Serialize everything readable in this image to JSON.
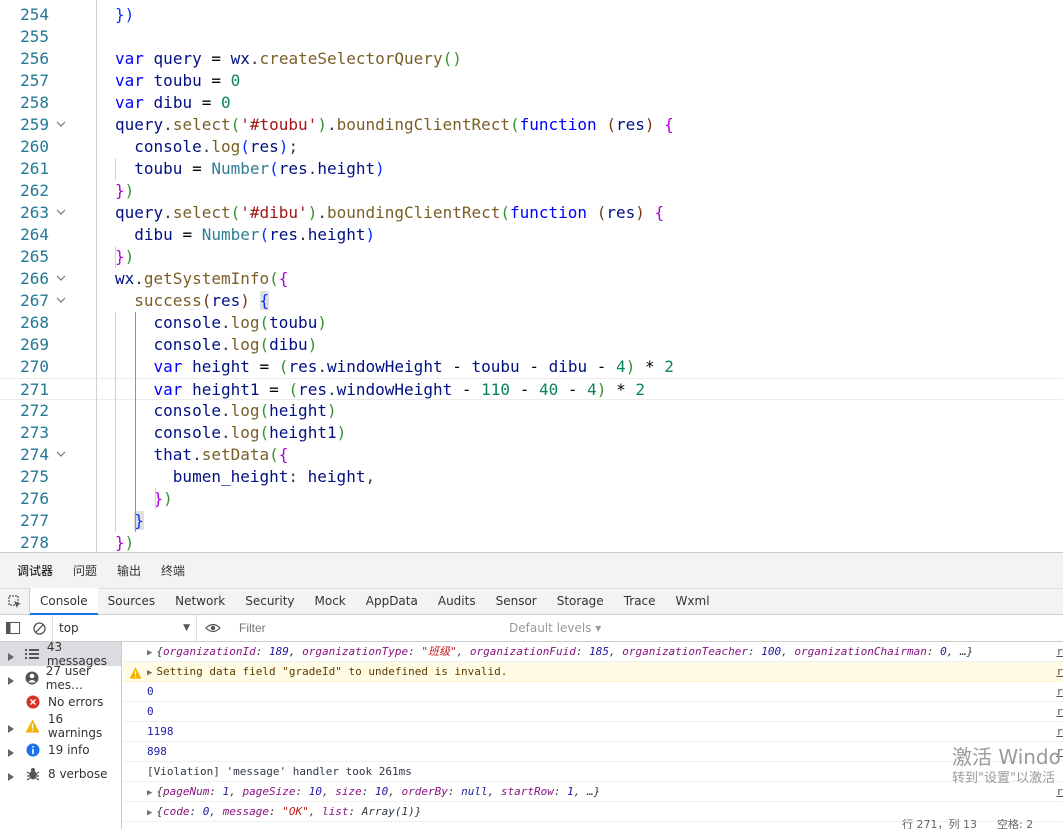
{
  "editor": {
    "lines": [
      {
        "n": "254",
        "fold": false,
        "html": "<span class=\"b1\">})</span>"
      },
      {
        "n": "255",
        "fold": false,
        "html": ""
      },
      {
        "n": "256",
        "fold": false,
        "html": "<span class=\"kw\">var</span> <span class=\"var\">query</span> <span class=\"op\">=</span> <span class=\"var\">wx</span>.<span class=\"fn\">createSelectorQuery</span><span class=\"b2\">()</span>"
      },
      {
        "n": "257",
        "fold": false,
        "html": "<span class=\"kw\">var</span> <span class=\"var\">toubu</span> <span class=\"op\">=</span> <span class=\"num\">0</span>"
      },
      {
        "n": "258",
        "fold": false,
        "html": "<span class=\"kw\">var</span> <span class=\"var\">dibu</span> <span class=\"op\">=</span> <span class=\"num\">0</span>"
      },
      {
        "n": "259",
        "fold": true,
        "html": "<span class=\"var\">query</span>.<span class=\"fn\">select</span><span class=\"b2\">(</span><span class=\"str\">'#toubu'</span><span class=\"b2\">)</span>.<span class=\"fn\">boundingClientRect</span><span class=\"b2\">(</span><span class=\"kw\">function</span> <span class=\"b3\">(</span><span class=\"var\">res</span><span class=\"b3\">)</span> <span class=\"p1\">{</span>"
      },
      {
        "n": "260",
        "fold": false,
        "html": "  <span class=\"var\">console</span>.<span class=\"fn\">log</span><span class=\"b1\">(</span><span class=\"var\">res</span><span class=\"b1\">)</span>;"
      },
      {
        "n": "261",
        "fold": false,
        "html": "  <span class=\"var\">toubu</span> <span class=\"op\">=</span> <span class=\"fn2\">Number</span><span class=\"b1\">(</span><span class=\"var\">res</span>.<span class=\"var\">height</span><span class=\"b1\">)</span>"
      },
      {
        "n": "262",
        "fold": false,
        "html": "<span class=\"p1\">}</span><span class=\"b2\">)</span>"
      },
      {
        "n": "263",
        "fold": true,
        "html": "<span class=\"var\">query</span>.<span class=\"fn\">select</span><span class=\"b2\">(</span><span class=\"str\">'#dibu'</span><span class=\"b2\">)</span>.<span class=\"fn\">boundingClientRect</span><span class=\"b2\">(</span><span class=\"kw\">function</span> <span class=\"b3\">(</span><span class=\"var\">res</span><span class=\"b3\">)</span> <span class=\"p1\">{</span>"
      },
      {
        "n": "264",
        "fold": false,
        "html": "  <span class=\"var\">dibu</span> <span class=\"op\">=</span> <span class=\"fn2\">Number</span><span class=\"b1\">(</span><span class=\"var\">res</span>.<span class=\"var\">height</span><span class=\"b1\">)</span>"
      },
      {
        "n": "265",
        "fold": false,
        "html": "<span class=\"p1\">}</span><span class=\"b2\">)</span>"
      },
      {
        "n": "266",
        "fold": true,
        "html": "<span class=\"var\">wx</span>.<span class=\"fn\">getSystemInfo</span><span class=\"b2\">(</span><span class=\"p1\">{</span>"
      },
      {
        "n": "267",
        "fold": true,
        "html": "  <span class=\"fn\">success</span><span class=\"b3\">(</span><span class=\"var\">res</span><span class=\"b3\">)</span> <span class=\"b1\" style=\"background:#e0e0e0\">{</span>"
      },
      {
        "n": "268",
        "fold": false,
        "html": "    <span class=\"var\">console</span>.<span class=\"fn\">log</span><span class=\"b2\">(</span><span class=\"var\">toubu</span><span class=\"b2\">)</span>"
      },
      {
        "n": "269",
        "fold": false,
        "html": "    <span class=\"var\">console</span>.<span class=\"fn\">log</span><span class=\"b2\">(</span><span class=\"var\">dibu</span><span class=\"b2\">)</span>"
      },
      {
        "n": "270",
        "fold": false,
        "html": "    <span class=\"kw\">var</span> <span class=\"var\">height</span> <span class=\"op\">=</span> <span class=\"b2\">(</span><span class=\"var\">res</span>.<span class=\"var\">windowHeight</span> <span class=\"op\">-</span> <span class=\"var\">toubu</span> <span class=\"op\">-</span> <span class=\"var\">dibu</span> <span class=\"op\">-</span> <span class=\"num\">4</span><span class=\"b2\">)</span> <span class=\"op\">*</span> <span class=\"num\">2</span>"
      },
      {
        "n": "271",
        "fold": false,
        "current": true,
        "html": "    <span class=\"kw\">var</span> <span class=\"var\">height1</span> <span class=\"op\">=</span> <span class=\"b2\">(</span><span class=\"var\">res</span>.<span class=\"var\">windowHeight</span> <span class=\"op\">-</span> <span class=\"num\">110</span> <span class=\"op\">-</span> <span class=\"num\">40</span> <span class=\"op\">-</span> <span class=\"num\">4</span><span class=\"b2\">)</span> <span class=\"op\">*</span> <span class=\"num\">2</span>"
      },
      {
        "n": "272",
        "fold": false,
        "html": "    <span class=\"var\">console</span>.<span class=\"fn\">log</span><span class=\"b2\">(</span><span class=\"var\">height</span><span class=\"b2\">)</span>"
      },
      {
        "n": "273",
        "fold": false,
        "html": "    <span class=\"var\">console</span>.<span class=\"fn\">log</span><span class=\"b2\">(</span><span class=\"var\">height1</span><span class=\"b2\">)</span>"
      },
      {
        "n": "274",
        "fold": true,
        "html": "    <span class=\"var\">that</span>.<span class=\"fn\">setData</span><span class=\"b2\">(</span><span class=\"p1\">{</span>"
      },
      {
        "n": "275",
        "fold": false,
        "html": "      <span class=\"var\">bumen_height</span>: <span class=\"var\">height</span>,"
      },
      {
        "n": "276",
        "fold": false,
        "html": "    <span class=\"p1\">}</span><span class=\"b2\">)</span>"
      },
      {
        "n": "277",
        "fold": false,
        "html": "  <span class=\"b1\" style=\"background:#e0e0e0\">}</span>"
      },
      {
        "n": "278",
        "fold": false,
        "html": "<span class=\"p1\">}</span><span class=\"b2\">)</span>"
      }
    ]
  },
  "devtools": {
    "outer_tabs": [
      "调试器",
      "问题",
      "输出",
      "终端"
    ],
    "panel_tabs": [
      "Console",
      "Sources",
      "Network",
      "Security",
      "Mock",
      "AppData",
      "Audits",
      "Sensor",
      "Storage",
      "Trace",
      "Wxml"
    ],
    "active_panel_tab": "Console",
    "context": "top",
    "filter_placeholder": "Filter",
    "levels_label": "Default levels ▾",
    "sidebar": [
      {
        "label": "43 messages",
        "icon": "list-icon",
        "active": true,
        "expandable": true
      },
      {
        "label": "27 user mes…",
        "icon": "user-icon",
        "active": false,
        "expandable": true
      },
      {
        "label": "No errors",
        "icon": "error-icon",
        "active": false,
        "expandable": false
      },
      {
        "label": "16 warnings",
        "icon": "warning-icon",
        "active": false,
        "expandable": true
      },
      {
        "label": "19 info",
        "icon": "info-icon",
        "active": false,
        "expandable": true
      },
      {
        "label": "8 verbose",
        "icon": "bug-icon",
        "active": false,
        "expandable": true
      }
    ],
    "messages": [
      {
        "type": "object",
        "html": "{<span class=\"k\">organizationId</span>: <span class=\"nm\">189</span>, <span class=\"k\">organizationType</span>: <span class=\"sv\">\"班级\"</span>, <span class=\"k\">organizationFuid</span>: <span class=\"nm\">185</span>, <span class=\"k\">organizationTeacher</span>: <span class=\"nm\">100</span>, <span class=\"k\">organizationChairman</span>: <span class=\"nm\">0</span>, …}",
        "italic": true,
        "link": "r"
      },
      {
        "type": "warning",
        "html": "Setting data field \"gradeId\" to undefined is invalid.",
        "link": "r"
      },
      {
        "type": "number",
        "html": "0",
        "link": "r"
      },
      {
        "type": "number",
        "html": "0",
        "link": "r"
      },
      {
        "type": "number",
        "html": "1198",
        "link": "r"
      },
      {
        "type": "number",
        "html": "898",
        "link": "r"
      },
      {
        "type": "violation",
        "html": "[Violation] 'message' handler took 261ms",
        "link": ""
      },
      {
        "type": "object",
        "html": "{<span class=\"k\">pageNum</span>: <span class=\"nm\">1</span>, <span class=\"k\">pageSize</span>: <span class=\"nm\">10</span>, <span class=\"k\">size</span>: <span class=\"nm\">10</span>, <span class=\"k\">orderBy</span>: <span class=\"nm\">null</span>, <span class=\"k\">startRow</span>: <span class=\"nm\">1</span>, …}",
        "italic": true,
        "link": "r"
      },
      {
        "type": "object",
        "html": "{<span class=\"k\">code</span>: <span class=\"nm\">0</span>, <span class=\"k\">message</span>: <span class=\"sv\">\"OK\"</span>, <span class=\"k\">list</span>: Array(1)}",
        "italic": true,
        "link": ""
      }
    ]
  },
  "watermark": {
    "line1": "激活 Windo",
    "line2": "转到\"设置\"以激活"
  },
  "statusbar": {
    "position": "行 271，列 13",
    "spaces": "空格: 2"
  },
  "colors": {
    "accent": "#1a73e8",
    "line_number": "#237893",
    "warning_bg": "#fffbe5"
  }
}
